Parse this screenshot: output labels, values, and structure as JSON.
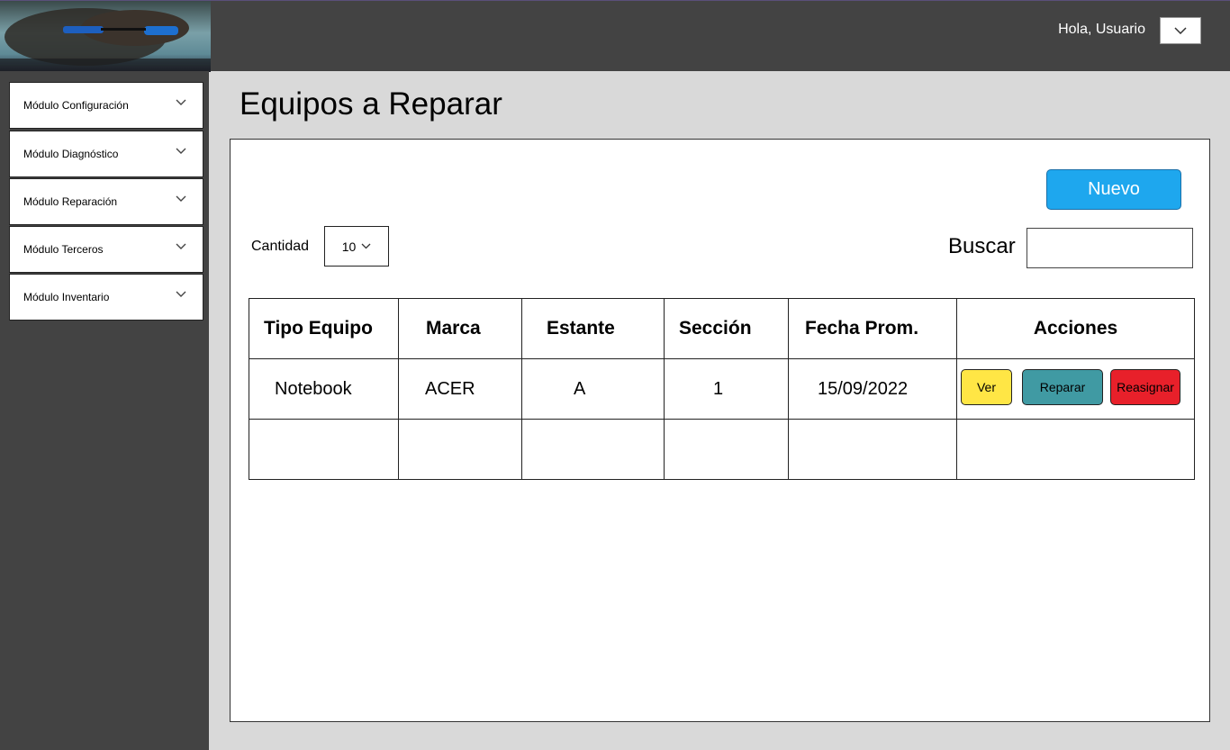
{
  "header": {
    "greeting": "Hola, Usuario"
  },
  "sidebar": {
    "items": [
      {
        "label": "Módulo Configuración"
      },
      {
        "label": "Módulo Diagnóstico"
      },
      {
        "label": "Módulo Reparación"
      },
      {
        "label": "Módulo Terceros"
      },
      {
        "label": "Módulo Inventario"
      }
    ]
  },
  "page": {
    "title": "Equipos a Reparar"
  },
  "toolbar": {
    "new_label": "Nuevo",
    "quantity_label": "Cantidad",
    "quantity_value": "10",
    "search_label": "Buscar",
    "search_value": ""
  },
  "table": {
    "headers": [
      "Tipo Equipo",
      "Marca",
      "Estante",
      "Sección",
      "Fecha Prom.",
      "Acciones"
    ],
    "rows": [
      [
        "Notebook",
        "ACER",
        "A",
        "1",
        "15/09/2022"
      ]
    ],
    "actions": {
      "view": "Ver",
      "repair": "Reparar",
      "reassign": "Reasignar"
    }
  },
  "colors": {
    "topbar": "#434343",
    "sidebar": "#434343",
    "content_bg": "#d9d9d9",
    "nuevo_button": "#1ea7ee",
    "ver_button": "#ffe645",
    "reparar_button": "#409aa3",
    "reasignar_button": "#e8202a"
  },
  "icons": {
    "user_dropdown": "chevron-down-icon",
    "sidebar_item": "chevron-down-icon",
    "quantity_select": "chevron-down-icon",
    "logo": "logo-image"
  }
}
